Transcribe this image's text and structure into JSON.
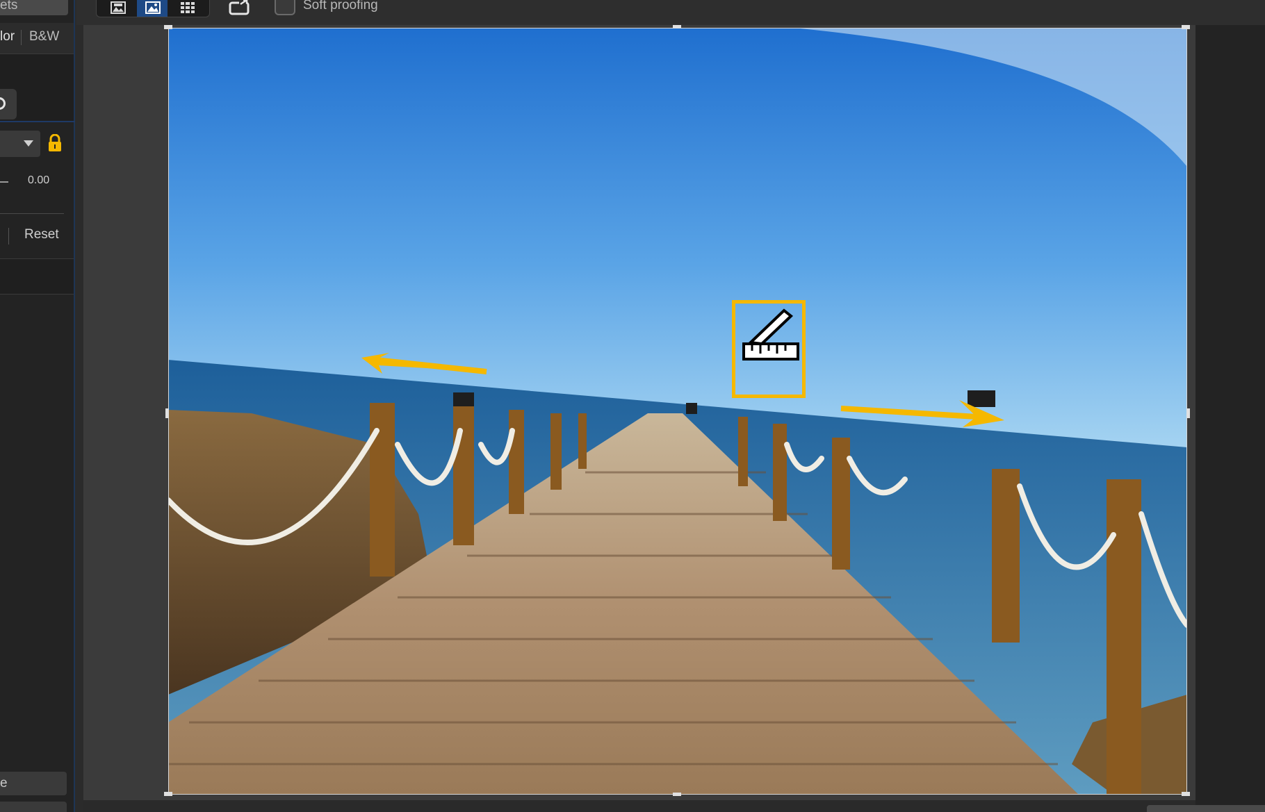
{
  "left_panel": {
    "top_tab_text": "ets",
    "mode_tabs": [
      "lor",
      "B&W"
    ],
    "slider_value": "0.00",
    "reset_label": "Reset",
    "bottom_button_text": "e"
  },
  "toolbar": {
    "soft_proofing_label": "Soft proofing",
    "soft_proofing_checked": false,
    "view_buttons": [
      "before-after-view",
      "single-view",
      "grid-view"
    ],
    "active_view": "single-view"
  },
  "canvas": {
    "background_color": "#3b3b3b",
    "overlay_icons": [
      "ruler-straighten-icon",
      "rotate-left-arrow",
      "rotate-right-arrow"
    ],
    "accent_color": "#f5b800"
  }
}
